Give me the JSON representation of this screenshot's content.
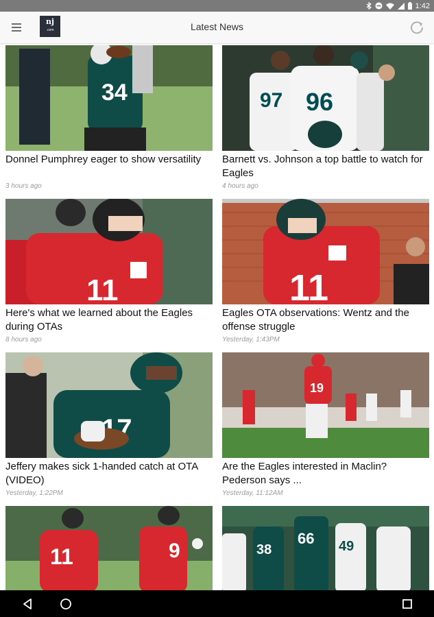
{
  "status_bar": {
    "time": "1:42",
    "icons": [
      "bluetooth-icon",
      "do-not-disturb-icon",
      "wifi-icon",
      "signal-icon",
      "battery-icon"
    ]
  },
  "app_bar": {
    "title": "Latest News",
    "logo_text": "nj",
    "logo_subtext": ".com",
    "menu_icon": "hamburger-menu-icon",
    "refresh_icon": "refresh-icon"
  },
  "articles": [
    {
      "headline": "Donnel Pumphrey eager to show versatility",
      "time": "3 hours ago",
      "image": "player in green jersey number 34 catching a football at practice"
    },
    {
      "headline": "Barnett vs. Johnson a top battle to watch for Eagles",
      "time": "4 hours ago",
      "image": "players in white jerseys 97 and 96 on sideline"
    },
    {
      "headline": "Here's what we learned about the Eagles during OTAs",
      "time": "8 hours ago",
      "image": "quarterback in red jersey number 11 with helmet"
    },
    {
      "headline": "Eagles OTA observations: Wentz and the offense struggle",
      "time": "Yesterday, 1:43PM",
      "image": "quarterback in red jersey number 11 near brick wall"
    },
    {
      "headline": "Jeffery makes sick 1-handed catch at OTA (VIDEO)",
      "time": "Yesterday, 1:22PM",
      "image": "receiver in green jersey number 17 making one-handed catch"
    },
    {
      "headline": "Are the Eagles interested in Maclin? Pederson says ...",
      "time": "Yesterday, 11:12AM",
      "image": "player in red jersey number 19 running with ball in stadium"
    },
    {
      "headline": "",
      "time": "",
      "image": "quarterbacks in red jerseys 11 and 9 throwing"
    },
    {
      "headline": "",
      "time": "",
      "image": "team huddle in green and white jerseys 66, 38, 49"
    }
  ],
  "colors": {
    "eagles_green": "#004c54",
    "practice_red": "#d7272f",
    "field_green": "#6fa05a"
  },
  "nav_bar": {
    "back_icon": "back-triangle-icon",
    "home_icon": "home-circle-icon",
    "recents_icon": "recents-square-icon"
  }
}
